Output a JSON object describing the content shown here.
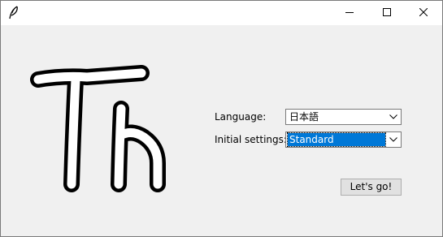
{
  "window": {
    "title": "",
    "app_icon": "feather-icon",
    "controls": [
      "minimize-icon",
      "maximize-icon",
      "close-icon"
    ]
  },
  "logo": {
    "text": "Th",
    "style": "thick black outline, white fill"
  },
  "form": {
    "language_label": "Language:",
    "language_value": "日本語",
    "settings_label": "Initial settings:",
    "settings_value": "Standard",
    "dropdown_icon": "chevron-down-icon"
  },
  "actions": {
    "go_label": "Let's go!"
  },
  "colors": {
    "window_bg": "#f0f0f0",
    "titlebar_bg": "#ffffff",
    "selection": "#0078d7",
    "button_bg": "#e1e1e1"
  }
}
